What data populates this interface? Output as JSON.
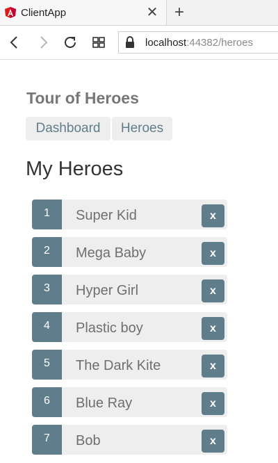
{
  "browser": {
    "tab_title": "ClientApp",
    "close_tab_glyph": "✕",
    "new_tab_glyph": "+",
    "url_host": "localhost",
    "url_rest": ":44382/heroes",
    "favicon_color": "#dd1b16",
    "icons": [
      "angular-favicon-icon",
      "close-icon",
      "plus-icon",
      "back-arrow-icon",
      "forward-arrow-icon",
      "reload-icon",
      "tab-grid-icon",
      "lock-icon"
    ]
  },
  "app": {
    "title": "Tour of Heroes",
    "nav": [
      {
        "label": "Dashboard"
      },
      {
        "label": "Heroes"
      }
    ],
    "heading": "My Heroes",
    "delete_label": "x",
    "accent_color": "#607d8b",
    "heroes": [
      {
        "id": "1",
        "name": "Super Kid"
      },
      {
        "id": "2",
        "name": "Mega Baby"
      },
      {
        "id": "3",
        "name": "Hyper Girl"
      },
      {
        "id": "4",
        "name": "Plastic boy"
      },
      {
        "id": "5",
        "name": "The Dark Kite"
      },
      {
        "id": "6",
        "name": "Blue Ray"
      },
      {
        "id": "7",
        "name": "Bob"
      }
    ]
  }
}
